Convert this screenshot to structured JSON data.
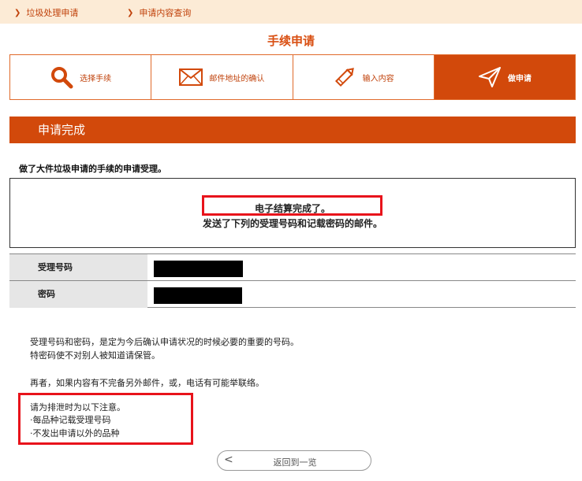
{
  "breadcrumbs": [
    {
      "label": "垃圾处理申请"
    },
    {
      "label": "申请内容查询"
    }
  ],
  "page_title": "手续申请",
  "steps": [
    {
      "label": "选择手续",
      "icon": "search-icon"
    },
    {
      "label": "邮件地址的确认",
      "icon": "envelope-icon"
    },
    {
      "label": "输入内容",
      "icon": "pencil-icon"
    },
    {
      "label": "做申请",
      "icon": "send-icon",
      "active": true
    }
  ],
  "section_title": "申请完成",
  "intro_text": "做了大件垃圾申请的手续的申请受理。",
  "message": {
    "line1": "电子结算完成了。",
    "line2": "发送了下列的受理号码和记载密码的邮件。"
  },
  "info_table": {
    "rows": [
      {
        "label": "受理号码"
      },
      {
        "label": "密码"
      }
    ]
  },
  "notes": {
    "p1_line1": "受理号码和密码，是定为今后确认申请状况的时候必要的重要的号码。",
    "p1_line2": "特密码使不对别人被知道请保管。",
    "p2": "再者，如果内容有不完备另外邮件，或，电话有可能举联络。",
    "p3_line1": "请为排泄时为以下注意。",
    "p3_line2": "·每品种记载受理号码",
    "p3_line3": "·不发出申请以外的品种"
  },
  "back_button": {
    "label": "返回到一览"
  },
  "colors": {
    "accent": "#d2490b",
    "highlight": "#e8131b",
    "crumb_bg": "#fcebd6"
  }
}
